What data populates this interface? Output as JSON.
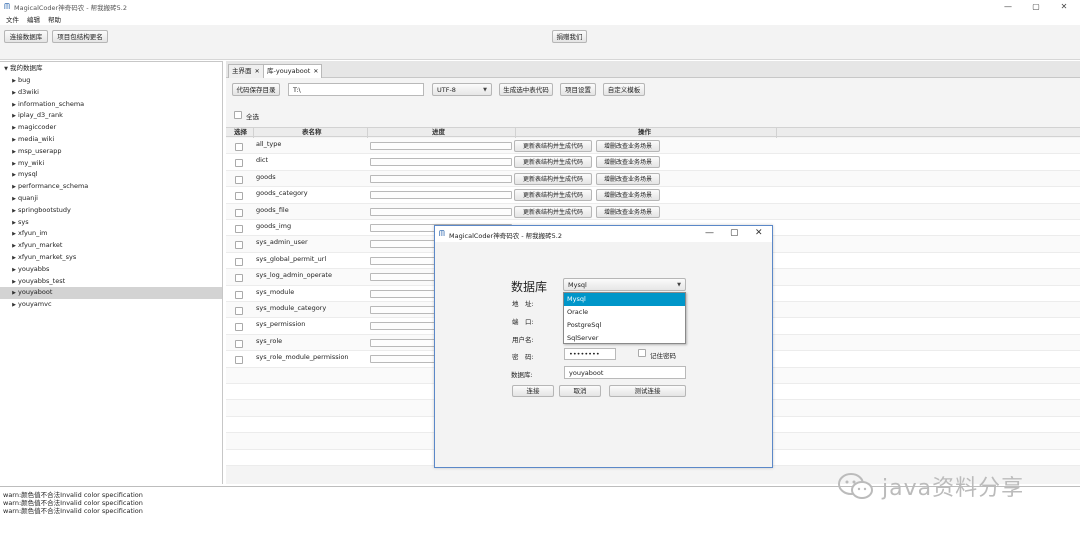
{
  "window": {
    "title": "MagicalCoder神奇码农 - 帮我搬砖5.2",
    "controls": [
      "—",
      "▢",
      "✕"
    ]
  },
  "menu": [
    "文件",
    "编辑",
    "帮助"
  ],
  "toolbar": {
    "connect_label": "连接数据库",
    "rename_label": "项目包结构更名",
    "donate_label": "捐赠我们"
  },
  "tree": {
    "root": "我的数据库",
    "items": [
      "bug",
      "d3wiki",
      "information_schema",
      "iplay_d3_rank",
      "magiccoder",
      "media_wiki",
      "msp_userapp",
      "my_wiki",
      "mysql",
      "performance_schema",
      "quanji",
      "springbootstudy",
      "sys",
      "xfyun_im",
      "xfyun_market",
      "xfyun_market_sys",
      "youyabbs",
      "youyabbs_test",
      "youyaboot",
      "youyamvc"
    ],
    "selected": "youyaboot"
  },
  "tabs": [
    {
      "label": "主界面",
      "close": "✕"
    },
    {
      "label": "库-youyaboot",
      "close": "✕"
    }
  ],
  "codegen": {
    "dir_button": "代码保存目录",
    "dir_value": "T:\\",
    "encoding": "UTF-8",
    "gen_selected": "生成选中表代码",
    "project_settings": "项目设置",
    "custom_template": "自定义模板",
    "select_all": "全选"
  },
  "grid": {
    "headers": {
      "select": "选择",
      "table": "表名称",
      "progress": "进度",
      "ops": "操作"
    },
    "action1": "更新表结构并生成代码",
    "action2": "增删改查业务场景",
    "rows": [
      "all_type",
      "dict",
      "goods",
      "goods_category",
      "goods_file",
      "goods_img",
      "sys_admin_user",
      "sys_global_permit_url",
      "sys_log_admin_operate",
      "sys_module",
      "sys_module_category",
      "sys_permission",
      "sys_role",
      "sys_role_module_permission"
    ]
  },
  "dialog": {
    "title": "MagicalCoder神奇码农 - 帮我搬砖5.2",
    "db_label": "数据库",
    "db_type_selected": "Mysql",
    "db_options": [
      "Mysql",
      "Oracle",
      "PostgreSql",
      "SqlServer"
    ],
    "address_label": "地　址:",
    "port_label": "端　口:",
    "user_label": "用户名:",
    "password_label": "密　码:",
    "password_value": "••••••••",
    "remember_label": "记住密码",
    "dbname_label": "数据库:",
    "dbname_value": "youyaboot",
    "connect_btn": "连接",
    "cancel_btn": "取消",
    "test_btn": "测试连接"
  },
  "log": {
    "lines": [
      "warn:颜色值不合法Invalid color specification",
      "warn:颜色值不合法Invalid color specification",
      "warn:颜色值不合法Invalid color specification"
    ]
  },
  "watermark": {
    "text": "java资料分享"
  }
}
